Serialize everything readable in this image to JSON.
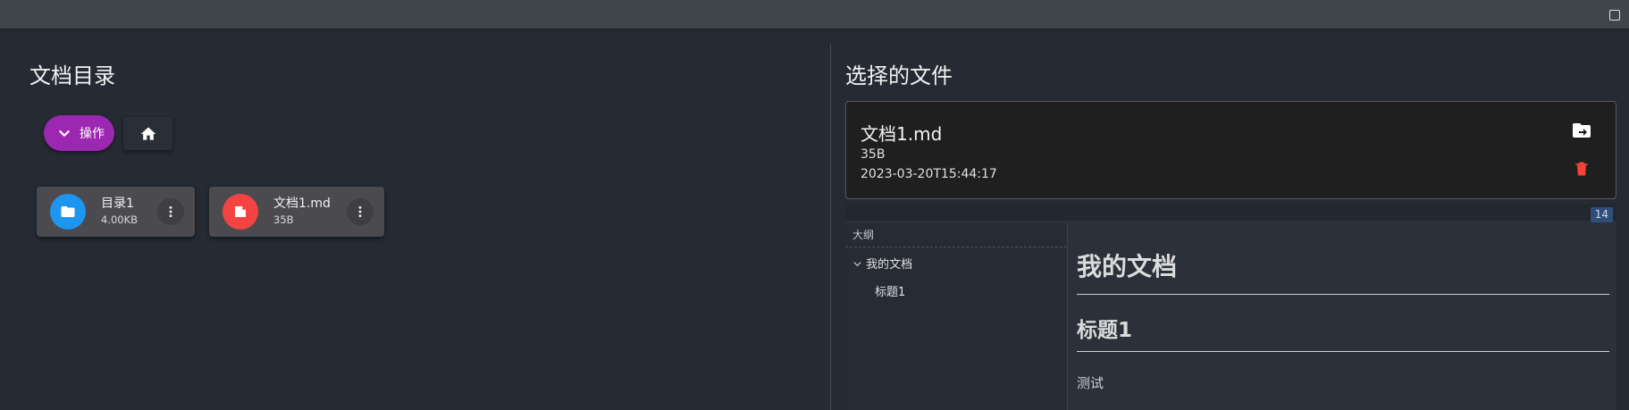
{
  "left": {
    "title": "文档目录",
    "action_button_label": "操作",
    "files": [
      {
        "name": "目录1",
        "size": "4.00KB",
        "type": "folder",
        "icon": "folder-icon",
        "color": "#1e96f0"
      },
      {
        "name": "文档1.md",
        "size": "35B",
        "type": "file",
        "icon": "file-icon",
        "color": "#f44343"
      }
    ]
  },
  "right": {
    "title": "选择的文件",
    "selected": {
      "name": "文档1.md",
      "size": "35B",
      "date": "2023-03-20T15:44:17"
    },
    "editor": {
      "badge": "14",
      "outline_title": "大纲",
      "outline_items": [
        "我的文档",
        "标题1"
      ],
      "preview": {
        "h1": "我的文档",
        "h2": "标题1",
        "paragraph": "测试"
      }
    }
  },
  "colors": {
    "accent": "#9c27b0",
    "folder": "#1e96f0",
    "file": "#f44343",
    "delete": "#f44336"
  }
}
